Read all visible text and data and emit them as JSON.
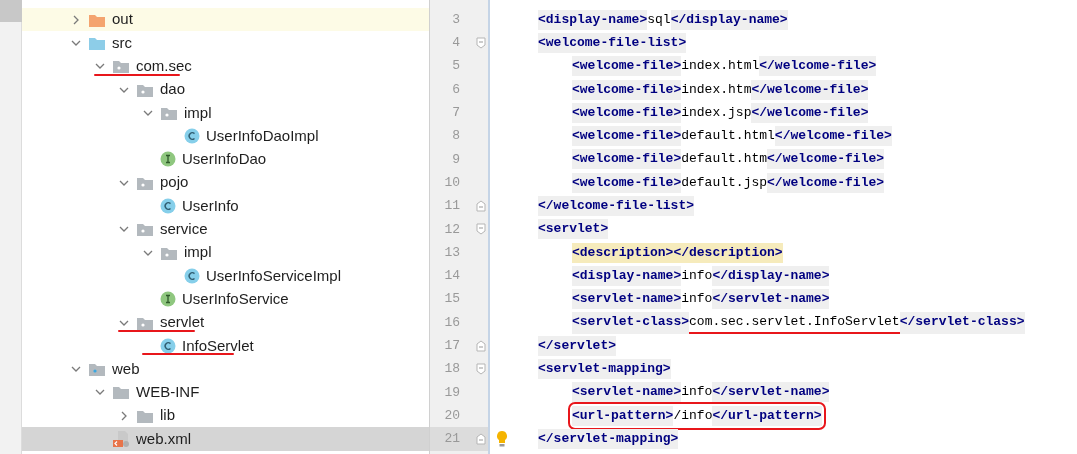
{
  "project_tree": [
    {
      "label": "out",
      "kind": "excluded-folder",
      "expanded": false,
      "selected": false,
      "highlighted": true,
      "marked": false
    },
    {
      "label": "src",
      "kind": "source-folder",
      "expanded": true,
      "selected": false,
      "highlighted": false,
      "marked": false,
      "children": [
        {
          "label": "com.sec",
          "kind": "package",
          "expanded": true,
          "selected": false,
          "highlighted": false,
          "marked": true,
          "children": [
            {
              "label": "dao",
              "kind": "package",
              "expanded": true,
              "selected": false,
              "highlighted": false,
              "marked": false,
              "children": [
                {
                  "label": "impl",
                  "kind": "package",
                  "expanded": true,
                  "selected": false,
                  "highlighted": false,
                  "marked": false,
                  "children": [
                    {
                      "label": "UserInfoDaoImpl",
                      "kind": "class",
                      "selected": false,
                      "highlighted": false,
                      "marked": false
                    }
                  ]
                },
                {
                  "label": "UserInfoDao",
                  "kind": "interface",
                  "selected": false,
                  "highlighted": false,
                  "marked": false
                }
              ]
            },
            {
              "label": "pojo",
              "kind": "package",
              "expanded": true,
              "selected": false,
              "highlighted": false,
              "marked": false,
              "children": [
                {
                  "label": "UserInfo",
                  "kind": "class",
                  "selected": false,
                  "highlighted": false,
                  "marked": false
                }
              ]
            },
            {
              "label": "service",
              "kind": "package",
              "expanded": true,
              "selected": false,
              "highlighted": false,
              "marked": false,
              "children": [
                {
                  "label": "impl",
                  "kind": "package",
                  "expanded": true,
                  "selected": false,
                  "highlighted": false,
                  "marked": false,
                  "children": [
                    {
                      "label": "UserInfoServiceImpl",
                      "kind": "class",
                      "selected": false,
                      "highlighted": false,
                      "marked": false
                    }
                  ]
                },
                {
                  "label": "UserInfoService",
                  "kind": "interface",
                  "selected": false,
                  "highlighted": false,
                  "marked": false
                }
              ]
            },
            {
              "label": "servlet",
              "kind": "package",
              "expanded": true,
              "selected": false,
              "highlighted": false,
              "marked": true,
              "children": [
                {
                  "label": "InfoServlet",
                  "kind": "class",
                  "selected": false,
                  "highlighted": false,
                  "marked": true
                }
              ]
            }
          ]
        }
      ]
    },
    {
      "label": "web",
      "kind": "web-folder",
      "expanded": true,
      "selected": false,
      "highlighted": false,
      "marked": false,
      "children": [
        {
          "label": "WEB-INF",
          "kind": "folder",
          "expanded": true,
          "selected": false,
          "highlighted": false,
          "marked": false,
          "children": [
            {
              "label": "lib",
              "kind": "folder",
              "expanded": false,
              "selected": false,
              "highlighted": false,
              "marked": false
            }
          ]
        },
        {
          "label": "web.xml",
          "kind": "xml",
          "selected": true,
          "highlighted": false,
          "marked": false
        }
      ]
    }
  ],
  "editor": {
    "lines": [
      {
        "number": "3",
        "fold_start": false,
        "fold_end": false,
        "warning": false,
        "current": false,
        "underlined": false,
        "boxed": false,
        "tokens": [
          {
            "kind": "tag",
            "text": "<display-name>"
          },
          {
            "kind": "text",
            "text": "sql"
          },
          {
            "kind": "tag",
            "text": "</display-name>"
          }
        ]
      },
      {
        "number": "4",
        "fold_start": true,
        "fold_end": false,
        "warning": false,
        "current": false,
        "underlined": false,
        "boxed": false,
        "tokens": [
          {
            "kind": "tag",
            "text": "<welcome-file-list>"
          }
        ],
        "children": [
          {
            "number": "5",
            "fold_start": false,
            "fold_end": false,
            "warning": false,
            "current": false,
            "underlined": false,
            "boxed": false,
            "tokens": [
              {
                "kind": "tag",
                "text": "<welcome-file>"
              },
              {
                "kind": "text",
                "text": "index.html"
              },
              {
                "kind": "tag",
                "text": "</welcome-file>"
              }
            ]
          },
          {
            "number": "6",
            "fold_start": false,
            "fold_end": false,
            "warning": false,
            "current": false,
            "underlined": false,
            "boxed": false,
            "tokens": [
              {
                "kind": "tag",
                "text": "<welcome-file>"
              },
              {
                "kind": "text",
                "text": "index.htm"
              },
              {
                "kind": "tag",
                "text": "</welcome-file>"
              }
            ]
          },
          {
            "number": "7",
            "fold_start": false,
            "fold_end": false,
            "warning": false,
            "current": false,
            "underlined": false,
            "boxed": false,
            "tokens": [
              {
                "kind": "tag",
                "text": "<welcome-file>"
              },
              {
                "kind": "text",
                "text": "index.jsp"
              },
              {
                "kind": "tag",
                "text": "</welcome-file>"
              }
            ]
          },
          {
            "number": "8",
            "fold_start": false,
            "fold_end": false,
            "warning": false,
            "current": false,
            "underlined": false,
            "boxed": false,
            "tokens": [
              {
                "kind": "tag",
                "text": "<welcome-file>"
              },
              {
                "kind": "text",
                "text": "default.html"
              },
              {
                "kind": "tag",
                "text": "</welcome-file>"
              }
            ]
          },
          {
            "number": "9",
            "fold_start": false,
            "fold_end": false,
            "warning": false,
            "current": false,
            "underlined": false,
            "boxed": false,
            "tokens": [
              {
                "kind": "tag",
                "text": "<welcome-file>"
              },
              {
                "kind": "text",
                "text": "default.htm"
              },
              {
                "kind": "tag",
                "text": "</welcome-file>"
              }
            ]
          },
          {
            "number": "10",
            "fold_start": false,
            "fold_end": false,
            "warning": false,
            "current": false,
            "underlined": false,
            "boxed": false,
            "tokens": [
              {
                "kind": "tag",
                "text": "<welcome-file>"
              },
              {
                "kind": "text",
                "text": "default.jsp"
              },
              {
                "kind": "tag",
                "text": "</welcome-file>"
              }
            ]
          }
        ]
      },
      {
        "number": "11",
        "fold_start": false,
        "fold_end": true,
        "warning": false,
        "current": false,
        "underlined": false,
        "boxed": false,
        "tokens": [
          {
            "kind": "tag",
            "text": "</welcome-file-list>"
          }
        ]
      },
      {
        "number": "12",
        "fold_start": true,
        "fold_end": false,
        "warning": false,
        "current": false,
        "underlined": false,
        "boxed": false,
        "tokens": [
          {
            "kind": "tag",
            "text": "<servlet>"
          }
        ],
        "children": [
          {
            "number": "13",
            "fold_start": false,
            "fold_end": false,
            "warning": true,
            "current": false,
            "underlined": false,
            "boxed": false,
            "tokens": [
              {
                "kind": "tag",
                "text": "<description></description>"
              }
            ]
          },
          {
            "number": "14",
            "fold_start": false,
            "fold_end": false,
            "warning": false,
            "current": false,
            "underlined": false,
            "boxed": false,
            "tokens": [
              {
                "kind": "tag",
                "text": "<display-name>"
              },
              {
                "kind": "text",
                "text": "info"
              },
              {
                "kind": "tag",
                "text": "</display-name>"
              }
            ]
          },
          {
            "number": "15",
            "fold_start": false,
            "fold_end": false,
            "warning": false,
            "current": false,
            "underlined": false,
            "boxed": false,
            "tokens": [
              {
                "kind": "tag",
                "text": "<servlet-name>"
              },
              {
                "kind": "text",
                "text": "info"
              },
              {
                "kind": "tag",
                "text": "</servlet-name>"
              }
            ]
          },
          {
            "number": "16",
            "fold_start": false,
            "fold_end": false,
            "warning": false,
            "current": false,
            "underlined": true,
            "boxed": false,
            "tokens": [
              {
                "kind": "tag",
                "text": "<servlet-class>"
              },
              {
                "kind": "text",
                "text": "com.sec.servlet.InfoServlet"
              },
              {
                "kind": "tag",
                "text": "</servlet-class>"
              }
            ]
          }
        ]
      },
      {
        "number": "17",
        "fold_start": false,
        "fold_end": true,
        "warning": false,
        "current": false,
        "underlined": false,
        "boxed": false,
        "tokens": [
          {
            "kind": "tag",
            "text": "</servlet>"
          }
        ]
      },
      {
        "number": "18",
        "fold_start": true,
        "fold_end": false,
        "warning": false,
        "current": false,
        "underlined": false,
        "boxed": false,
        "tokens": [
          {
            "kind": "tag",
            "text": "<servlet-mapping>"
          }
        ],
        "children": [
          {
            "number": "19",
            "fold_start": false,
            "fold_end": false,
            "warning": false,
            "current": false,
            "underlined": false,
            "boxed": false,
            "tokens": [
              {
                "kind": "tag",
                "text": "<servlet-name>"
              },
              {
                "kind": "text",
                "text": "info"
              },
              {
                "kind": "tag",
                "text": "</servlet-name>"
              }
            ]
          },
          {
            "number": "20",
            "fold_start": false,
            "fold_end": false,
            "warning": false,
            "current": false,
            "underlined": false,
            "boxed": true,
            "tokens": [
              {
                "kind": "tag",
                "text": "<url-pattern>"
              },
              {
                "kind": "text",
                "text": "/info"
              },
              {
                "kind": "tag",
                "text": "</url-pattern>"
              }
            ]
          }
        ]
      },
      {
        "number": "21",
        "fold_start": false,
        "fold_end": true,
        "warning": false,
        "current": true,
        "underlined": false,
        "boxed": false,
        "tokens": [
          {
            "kind": "tag",
            "text": "</servlet-mapping>"
          }
        ]
      }
    ]
  }
}
